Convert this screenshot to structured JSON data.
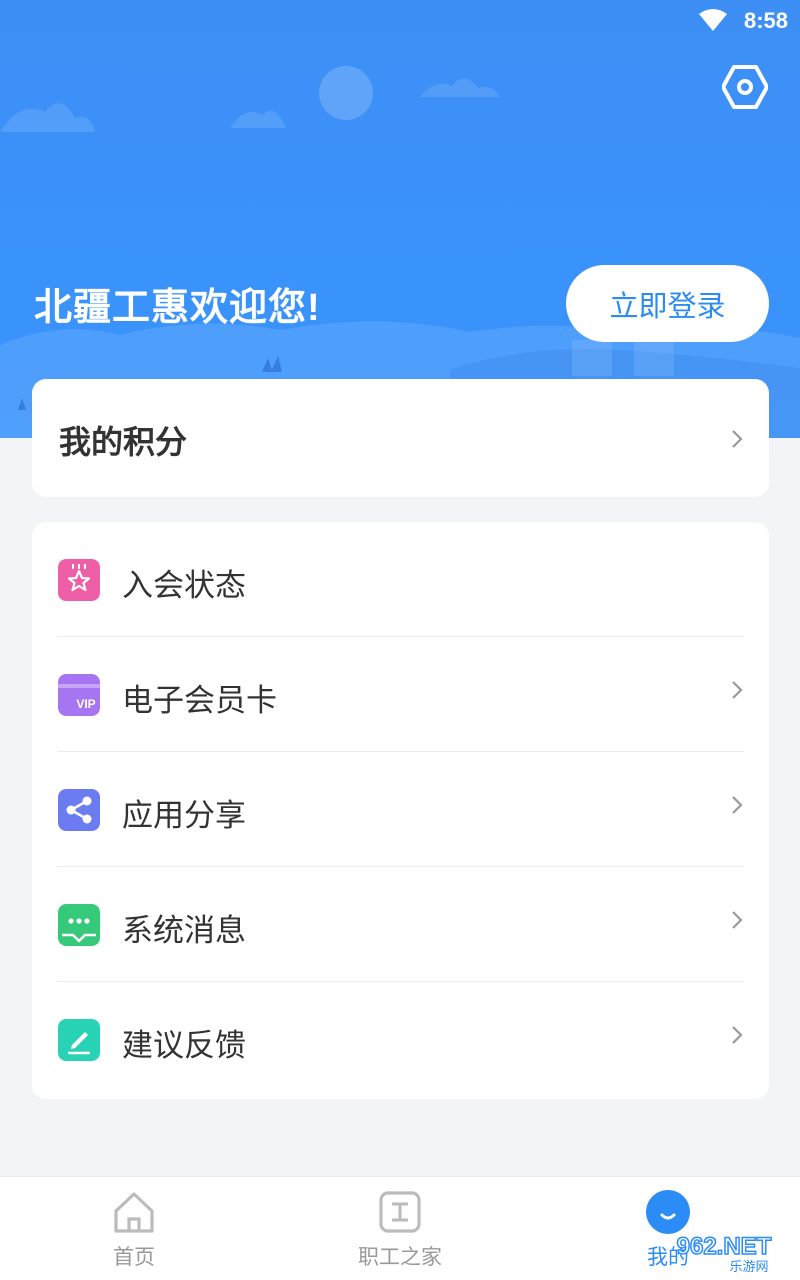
{
  "status_bar": {
    "time": "8:58",
    "wifi_icon": "wifi-icon"
  },
  "header": {
    "settings_icon": "gear-icon",
    "welcome": "北疆工惠欢迎您!",
    "login_label": "立即登录"
  },
  "points": {
    "title": "我的积分"
  },
  "menu": {
    "items": [
      {
        "label": "入会状态",
        "icon": "membership-star-icon",
        "color": "#ee5fa7",
        "chevron": false
      },
      {
        "label": "电子会员卡",
        "icon": "vip-card-icon",
        "color": "#a675f2",
        "chevron": true
      },
      {
        "label": "应用分享",
        "icon": "share-icon",
        "color": "#6b7cf2",
        "chevron": true
      },
      {
        "label": "系统消息",
        "icon": "message-icon",
        "color": "#36c97a",
        "chevron": true
      },
      {
        "label": "建议反馈",
        "icon": "feedback-edit-icon",
        "color": "#28d3b5",
        "chevron": true
      }
    ]
  },
  "tab_bar": {
    "tabs": [
      {
        "label": "首页",
        "icon": "home-icon",
        "active": false
      },
      {
        "label": "职工之家",
        "icon": "workers-home-icon",
        "active": false
      },
      {
        "label": "我的",
        "icon": "profile-icon",
        "active": true
      }
    ]
  },
  "watermark": {
    "text": "962.NET",
    "subtext": "乐游网"
  },
  "colors": {
    "accent": "#2b8cf6",
    "hero": "#3a92fb",
    "background": "#f3f4f8"
  }
}
